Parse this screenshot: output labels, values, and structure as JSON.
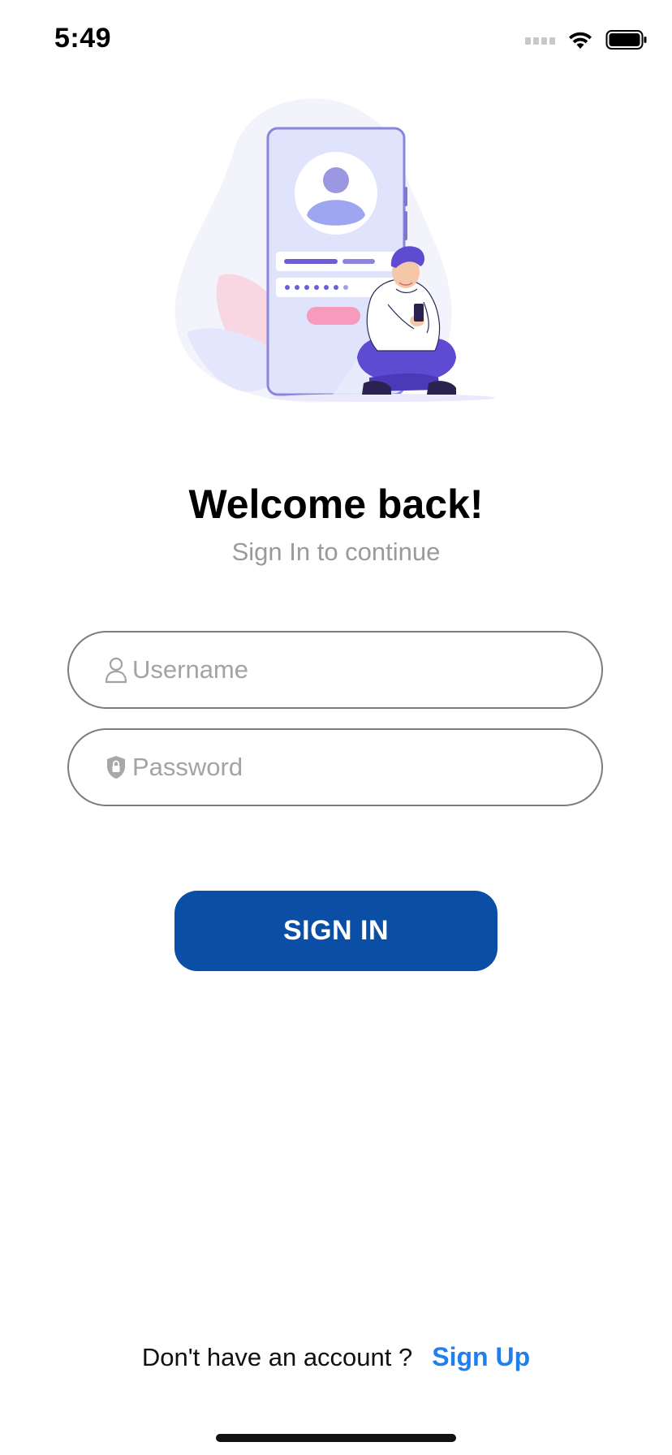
{
  "status_bar": {
    "time": "5:49",
    "icons": [
      "signal-icon",
      "wifi-icon",
      "battery-icon"
    ]
  },
  "illustration": {
    "icon": "login-illustration"
  },
  "header": {
    "title": "Welcome back!",
    "subtitle": "Sign In to continue"
  },
  "form": {
    "username": {
      "placeholder": "Username",
      "value": "",
      "icon": "user-icon"
    },
    "password": {
      "placeholder": "Password",
      "value": "",
      "icon": "lock-shield-icon"
    },
    "submit_label": "SIGN IN"
  },
  "footer": {
    "prompt": "Don't have an account ?",
    "link_label": "Sign Up"
  },
  "colors": {
    "primary_button": "#0a4ea5",
    "link": "#1f7ef0",
    "subtitle": "#9a9a9a",
    "field_border": "#7d7d7d"
  }
}
